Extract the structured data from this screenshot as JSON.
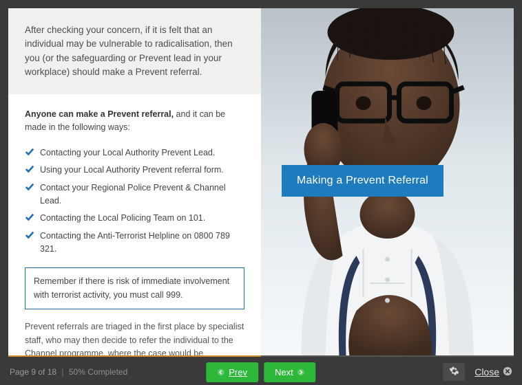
{
  "intro": "After checking your concern, if it is felt that an individual may be vulnerable to radicalisation, then you (or the safeguarding or Prevent lead in your workplace) should make a Prevent referral.",
  "lead": {
    "strong": "Anyone can make a Prevent referral,",
    "rest": " and it can be made in the following ways:"
  },
  "checklist": [
    "Contacting your Local Authority Prevent Lead.",
    "Using your Local Authority Prevent referral form.",
    "Contact your Regional Police Prevent & Channel Lead.",
    "Contacting the Local Policing Team on 101.",
    "Contacting the Anti-Terrorist Helpline on 0800 789 321."
  ],
  "callout": "Remember if there is risk of immediate involvement with terrorist activity, you must call 999.",
  "after": "Prevent referrals are triaged in the first place by specialist staff, who may then decide to refer the individual to the Channel programme, where the case would be considered by the Channel panel.",
  "banner": "Making a Prevent Referral",
  "footer": {
    "page_label": "Page 9 of 18",
    "completed_label": "50% Completed",
    "prev": "Prev",
    "next": "Next",
    "close": "Close"
  },
  "progress_percent": 50,
  "colors": {
    "accent_blue": "#1e7bbd",
    "check_blue": "#1d6fb8",
    "button_green": "#2db83a",
    "progress_orange": "#d28a2c"
  }
}
